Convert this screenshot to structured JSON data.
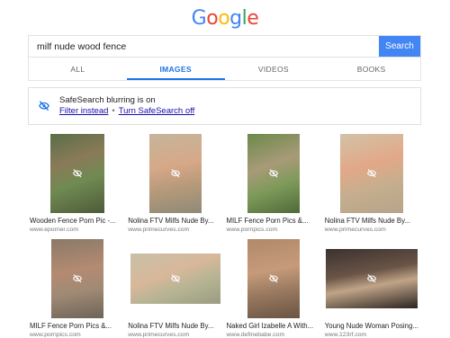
{
  "logo": {
    "letters": [
      "G",
      "o",
      "o",
      "g",
      "l",
      "e"
    ],
    "colors": [
      "#4285f4",
      "#ea4335",
      "#fbbc05",
      "#4285f4",
      "#34a853",
      "#ea4335"
    ]
  },
  "search": {
    "query": "milf nude wood fence",
    "button_label": "Search"
  },
  "tabs": [
    {
      "label": "ALL",
      "active": false
    },
    {
      "label": "IMAGES",
      "active": true
    },
    {
      "label": "VIDEOS",
      "active": false
    },
    {
      "label": "BOOKS",
      "active": false
    }
  ],
  "safesearch": {
    "title": "SafeSearch blurring is on",
    "filter_link": "Filter instead",
    "separator": "•",
    "turn_off_link": "Turn SafeSearch off"
  },
  "results": [
    {
      "caption": "Wooden Fence Porn Pic -...",
      "source": "www.eporner.com"
    },
    {
      "caption": "Nolina FTV Milfs Nude By...",
      "source": "www.primecurves.com"
    },
    {
      "caption": "MILF Fence Porn Pics &...",
      "source": "www.pornpics.com"
    },
    {
      "caption": "Nolina FTV Milfs Nude By...",
      "source": "www.primecurves.com"
    },
    {
      "caption": "MILF Fence Porn Pics &...",
      "source": "www.pornpics.com"
    },
    {
      "caption": "Nolina FTV Milfs Nude By...",
      "source": "www.primecurves.com"
    },
    {
      "caption": "Naked Girl Izabelle A With...",
      "source": "www.definebabe.com"
    },
    {
      "caption": "Young Nude Woman Posing...",
      "source": "www.123rf.com"
    }
  ],
  "colors": {
    "accent": "#4285f4",
    "link": "#1a0dab",
    "tab_active": "#1a73e8"
  },
  "icons": {
    "hidden": "eye-off-icon"
  }
}
